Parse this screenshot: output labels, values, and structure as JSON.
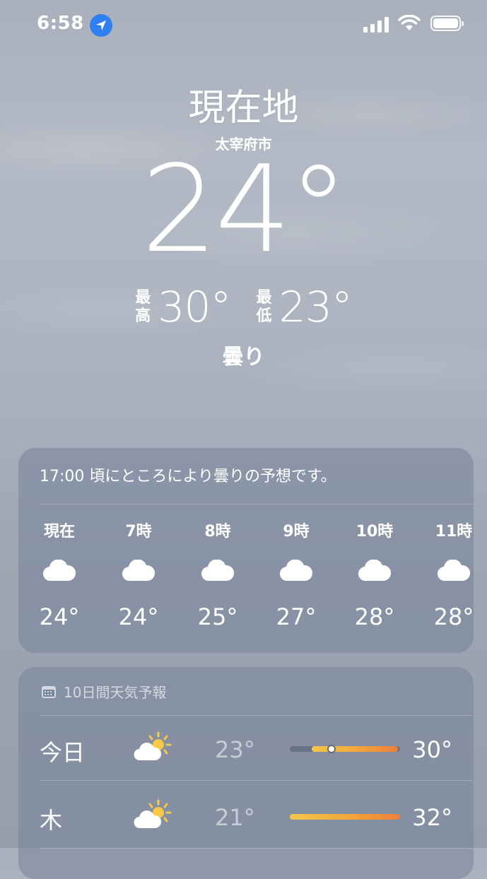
{
  "status": {
    "time": "6:58",
    "icons": [
      "location-arrow-icon",
      "signal-icon",
      "wifi-icon",
      "battery-icon"
    ]
  },
  "header": {
    "location": "現在地",
    "city": "太宰府市",
    "temperature": "24°",
    "high_label": [
      "最",
      "高"
    ],
    "high": "30°",
    "low_label": [
      "最",
      "低"
    ],
    "low": "23°",
    "condition": "曇り"
  },
  "hourly": {
    "summary": "17:00 頃にところにより曇りの予想です。",
    "items": [
      {
        "label": "現在",
        "icon": "cloud-icon",
        "temp": "24°"
      },
      {
        "label": "7時",
        "icon": "cloud-icon",
        "temp": "24°"
      },
      {
        "label": "8時",
        "icon": "cloud-icon",
        "temp": "25°"
      },
      {
        "label": "9時",
        "icon": "cloud-icon",
        "temp": "27°"
      },
      {
        "label": "10時",
        "icon": "cloud-icon",
        "temp": "28°"
      },
      {
        "label": "11時",
        "icon": "cloud-icon",
        "temp": "28°"
      }
    ]
  },
  "forecast": {
    "title": "10日間天気予報",
    "days": [
      {
        "day": "今日",
        "icon": "partly-sunny-icon",
        "low": "23°",
        "high": "30°",
        "range_start": 0.2,
        "range_end": 0.98,
        "current": 0.38
      },
      {
        "day": "木",
        "icon": "partly-sunny-icon",
        "low": "21°",
        "high": "32°",
        "range_start": 0.0,
        "range_end": 1.0
      }
    ]
  },
  "colors": {
    "bar_warm": "#f2a93b",
    "bar_hot": "#ee7f3a",
    "bar_yellow": "#f3c74a",
    "sun": "#f7c948",
    "card_bg": "rgba(118,132,153,0.55)"
  }
}
